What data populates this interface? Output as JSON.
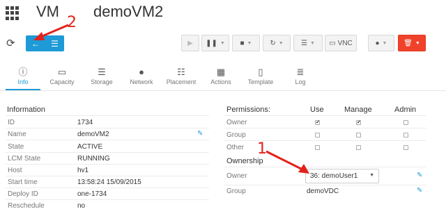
{
  "header": {
    "section": "VM",
    "name": "demoVM2"
  },
  "toolbar": {
    "vnc_label": "VNC",
    "icons": [
      "refresh-icon",
      "arrow-left-icon",
      "list-icon",
      "play-icon",
      "pause-icon",
      "stop-icon",
      "reload-icon",
      "list-icon",
      "monitor-icon",
      "user-icon",
      "trash-icon"
    ]
  },
  "tabs": [
    {
      "label": "Info",
      "icon": "i"
    },
    {
      "label": "Capacity",
      "icon": "laptop"
    },
    {
      "label": "Storage",
      "icon": "drive"
    },
    {
      "label": "Network",
      "icon": "globe"
    },
    {
      "label": "Placement",
      "icon": "sitemap"
    },
    {
      "label": "Actions",
      "icon": "calendar"
    },
    {
      "label": "Template",
      "icon": "file"
    },
    {
      "label": "Log",
      "icon": "file-text"
    }
  ],
  "information": {
    "title": "Information",
    "rows": [
      {
        "label": "ID",
        "value": "1734"
      },
      {
        "label": "Name",
        "value": "demoVM2"
      },
      {
        "label": "State",
        "value": "ACTIVE"
      },
      {
        "label": "LCM State",
        "value": "RUNNING"
      },
      {
        "label": "Host",
        "value": "hv1"
      },
      {
        "label": "Start time",
        "value": "13:58:24 15/09/2015"
      },
      {
        "label": "Deploy ID",
        "value": "one-1734"
      },
      {
        "label": "Reschedule",
        "value": "no"
      }
    ]
  },
  "permissions": {
    "title": "Permissions:",
    "columns": [
      "Use",
      "Manage",
      "Admin"
    ],
    "rows": [
      {
        "label": "Owner",
        "use": true,
        "manage": true,
        "admin": false
      },
      {
        "label": "Group",
        "use": false,
        "manage": false,
        "admin": false
      },
      {
        "label": "Other",
        "use": false,
        "manage": false,
        "admin": false
      }
    ]
  },
  "ownership": {
    "title": "Ownership",
    "owner_label": "Owner",
    "owner_value": "36: demoUser1",
    "group_label": "Group",
    "group_value": "demoVDC"
  },
  "annotations": {
    "one": "1",
    "two": "2"
  },
  "colors": {
    "accent": "#1e9ad6",
    "danger": "#f0422b",
    "annotation": "#e2221b"
  }
}
